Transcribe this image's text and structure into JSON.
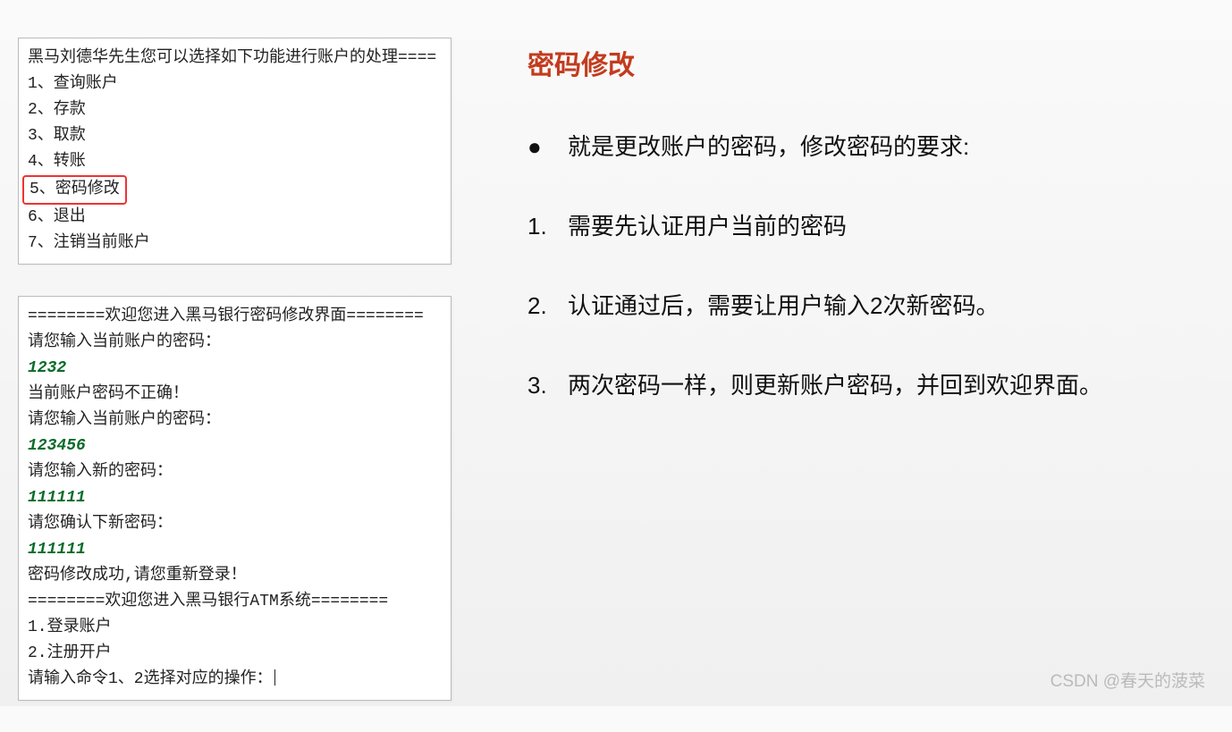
{
  "panel1": {
    "header": "黑马刘德华先生您可以选择如下功能进行账户的处理====",
    "items": [
      "1、查询账户",
      "2、存款",
      "3、取款",
      "4、转账",
      "5、密码修改",
      "6、退出",
      "7、注销当前账户"
    ],
    "highlightIndex": 4
  },
  "panel2": {
    "lines": [
      {
        "t": "========欢迎您进入黑马银行密码修改界面========",
        "cls": ""
      },
      {
        "t": "请您输入当前账户的密码：",
        "cls": ""
      },
      {
        "t": "1232",
        "cls": "user-input"
      },
      {
        "t": "当前账户密码不正确！",
        "cls": ""
      },
      {
        "t": "请您输入当前账户的密码：",
        "cls": ""
      },
      {
        "t": "123456",
        "cls": "user-input"
      },
      {
        "t": "请您输入新的密码：",
        "cls": ""
      },
      {
        "t": "111111",
        "cls": "user-input"
      },
      {
        "t": "请您确认下新密码：",
        "cls": ""
      },
      {
        "t": "111111",
        "cls": "user-input"
      },
      {
        "t": "密码修改成功,请您重新登录！",
        "cls": ""
      },
      {
        "t": "========欢迎您进入黑马银行ATM系统========",
        "cls": ""
      },
      {
        "t": "1.登录账户",
        "cls": ""
      },
      {
        "t": "2.注册开户",
        "cls": ""
      },
      {
        "t": "请输入命令1、2选择对应的操作：",
        "cls": "",
        "cursor": true
      }
    ]
  },
  "right": {
    "title": "密码修改",
    "bullet": "就是更改账户的密码，修改密码的要求:",
    "steps": [
      "需要先认证用户当前的密码",
      "认证通过后，需要让用户输入2次新密码。",
      "两次密码一样，则更新账户密码，并回到欢迎界面。"
    ]
  },
  "watermark": "CSDN @春天的菠菜"
}
